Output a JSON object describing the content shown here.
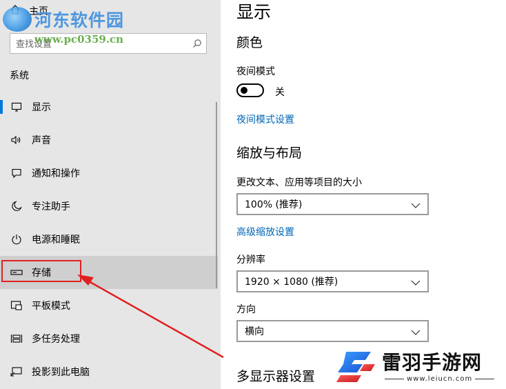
{
  "nav": {
    "home_label": "主页",
    "search_placeholder": "查找设置",
    "section_title": "系统",
    "items": [
      {
        "label": "显示",
        "icon": "monitor-icon"
      },
      {
        "label": "声音",
        "icon": "speaker-icon"
      },
      {
        "label": "通知和操作",
        "icon": "notification-icon"
      },
      {
        "label": "专注助手",
        "icon": "moon-icon"
      },
      {
        "label": "电源和睡眠",
        "icon": "power-icon"
      },
      {
        "label": "存储",
        "icon": "storage-icon"
      },
      {
        "label": "平板模式",
        "icon": "tablet-icon"
      },
      {
        "label": "多任务处理",
        "icon": "multitask-icon"
      },
      {
        "label": "投影到此电脑",
        "icon": "project-icon"
      }
    ]
  },
  "content": {
    "page_title": "显示",
    "color_heading": "颜色",
    "night_light_label": "夜间模式",
    "night_light_state": "关",
    "night_light_link": "夜间模式设置",
    "scale_heading": "缩放与布局",
    "text_size_label": "更改文本、应用等项目的大小",
    "scale_value": "100% (推荐)",
    "advanced_scale_link": "高级缩放设置",
    "resolution_label": "分辨率",
    "resolution_value": "1920 × 1080 (推荐)",
    "orientation_label": "方向",
    "orientation_value": "横向",
    "multi_display_heading": "多显示器设置"
  },
  "watermarks": {
    "top_site": "河东软件园",
    "top_url": "www.pc0359.cn",
    "bottom_site": "雷羽手游网",
    "bottom_url": "www.leiucn.com"
  },
  "colors": {
    "accent": "#0078d7",
    "link": "#0067b8",
    "annotation": "#e02020"
  }
}
